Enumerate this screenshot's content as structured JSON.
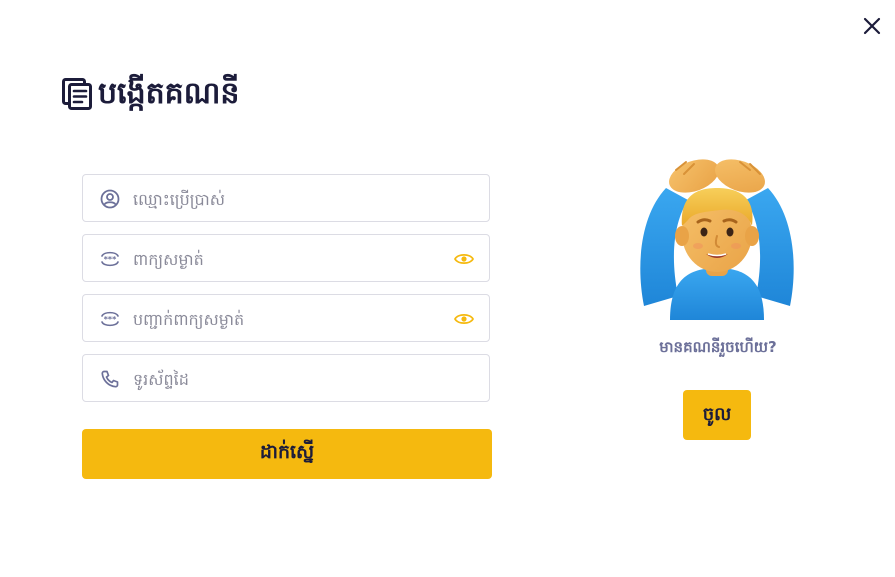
{
  "title": "បង្កើតគណនី",
  "fields": {
    "username": {
      "placeholder": "ឈ្មោះប្រើប្រាស់",
      "icon": "user-circle-icon"
    },
    "password": {
      "placeholder": "ពាក្យសម្ងាត់",
      "icon": "password-icon",
      "toggle_icon": "eye-icon"
    },
    "confirm_password": {
      "placeholder": "បញ្ជាក់ពាក្យសម្ងាត់",
      "icon": "password-icon",
      "toggle_icon": "eye-icon"
    },
    "phone": {
      "placeholder": "ទូរស័ព្ទដៃ",
      "icon": "phone-icon"
    }
  },
  "submit_label": "ដាក់ស្នើ",
  "side": {
    "question": "មានគណនីរួចហើយ?",
    "login_label": "ចូល",
    "illustration": "man-gesturing-ok-emoji"
  },
  "colors": {
    "accent": "#F5B90F",
    "title": "#1C1C3A",
    "muted": "#6C7099",
    "border": "#DCDCE4"
  }
}
